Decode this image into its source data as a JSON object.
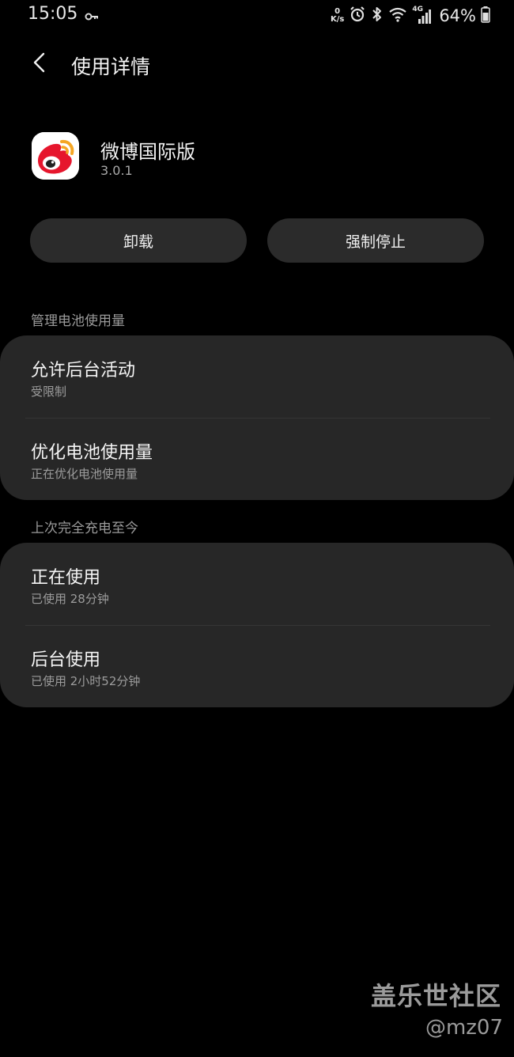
{
  "status_bar": {
    "time": "15:05",
    "net_speed_value": "0",
    "net_speed_unit": "K/s",
    "network_type": "4G",
    "battery_percent": "64%",
    "icons": [
      "key-icon",
      "alarm-icon",
      "bluetooth-icon",
      "wifi-icon",
      "signal-icon",
      "battery-icon"
    ]
  },
  "header": {
    "back_icon": "chevron-left-icon",
    "title": "使用详情"
  },
  "app": {
    "name": "微博国际版",
    "version": "3.0.1",
    "icon": "weibo-logo-icon"
  },
  "actions": {
    "uninstall_label": "卸载",
    "force_stop_label": "强制停止"
  },
  "battery_section": {
    "header": "管理电池使用量",
    "items": [
      {
        "title": "允许后台活动",
        "subtitle": "受限制"
      },
      {
        "title": "优化电池使用量",
        "subtitle": "正在优化电池使用量"
      }
    ]
  },
  "usage_section": {
    "header": "上次完全充电至今",
    "items": [
      {
        "title": "正在使用",
        "subtitle": "已使用 28分钟"
      },
      {
        "title": "后台使用",
        "subtitle": "已使用 2小时52分钟"
      }
    ]
  },
  "watermark": {
    "brand": "盖乐世社区",
    "user": "@mz07"
  },
  "colors": {
    "background": "#000000",
    "card": "#272727",
    "button": "#2b2b2b",
    "weibo_red": "#e6162d",
    "weibo_orange": "#f5a623"
  }
}
